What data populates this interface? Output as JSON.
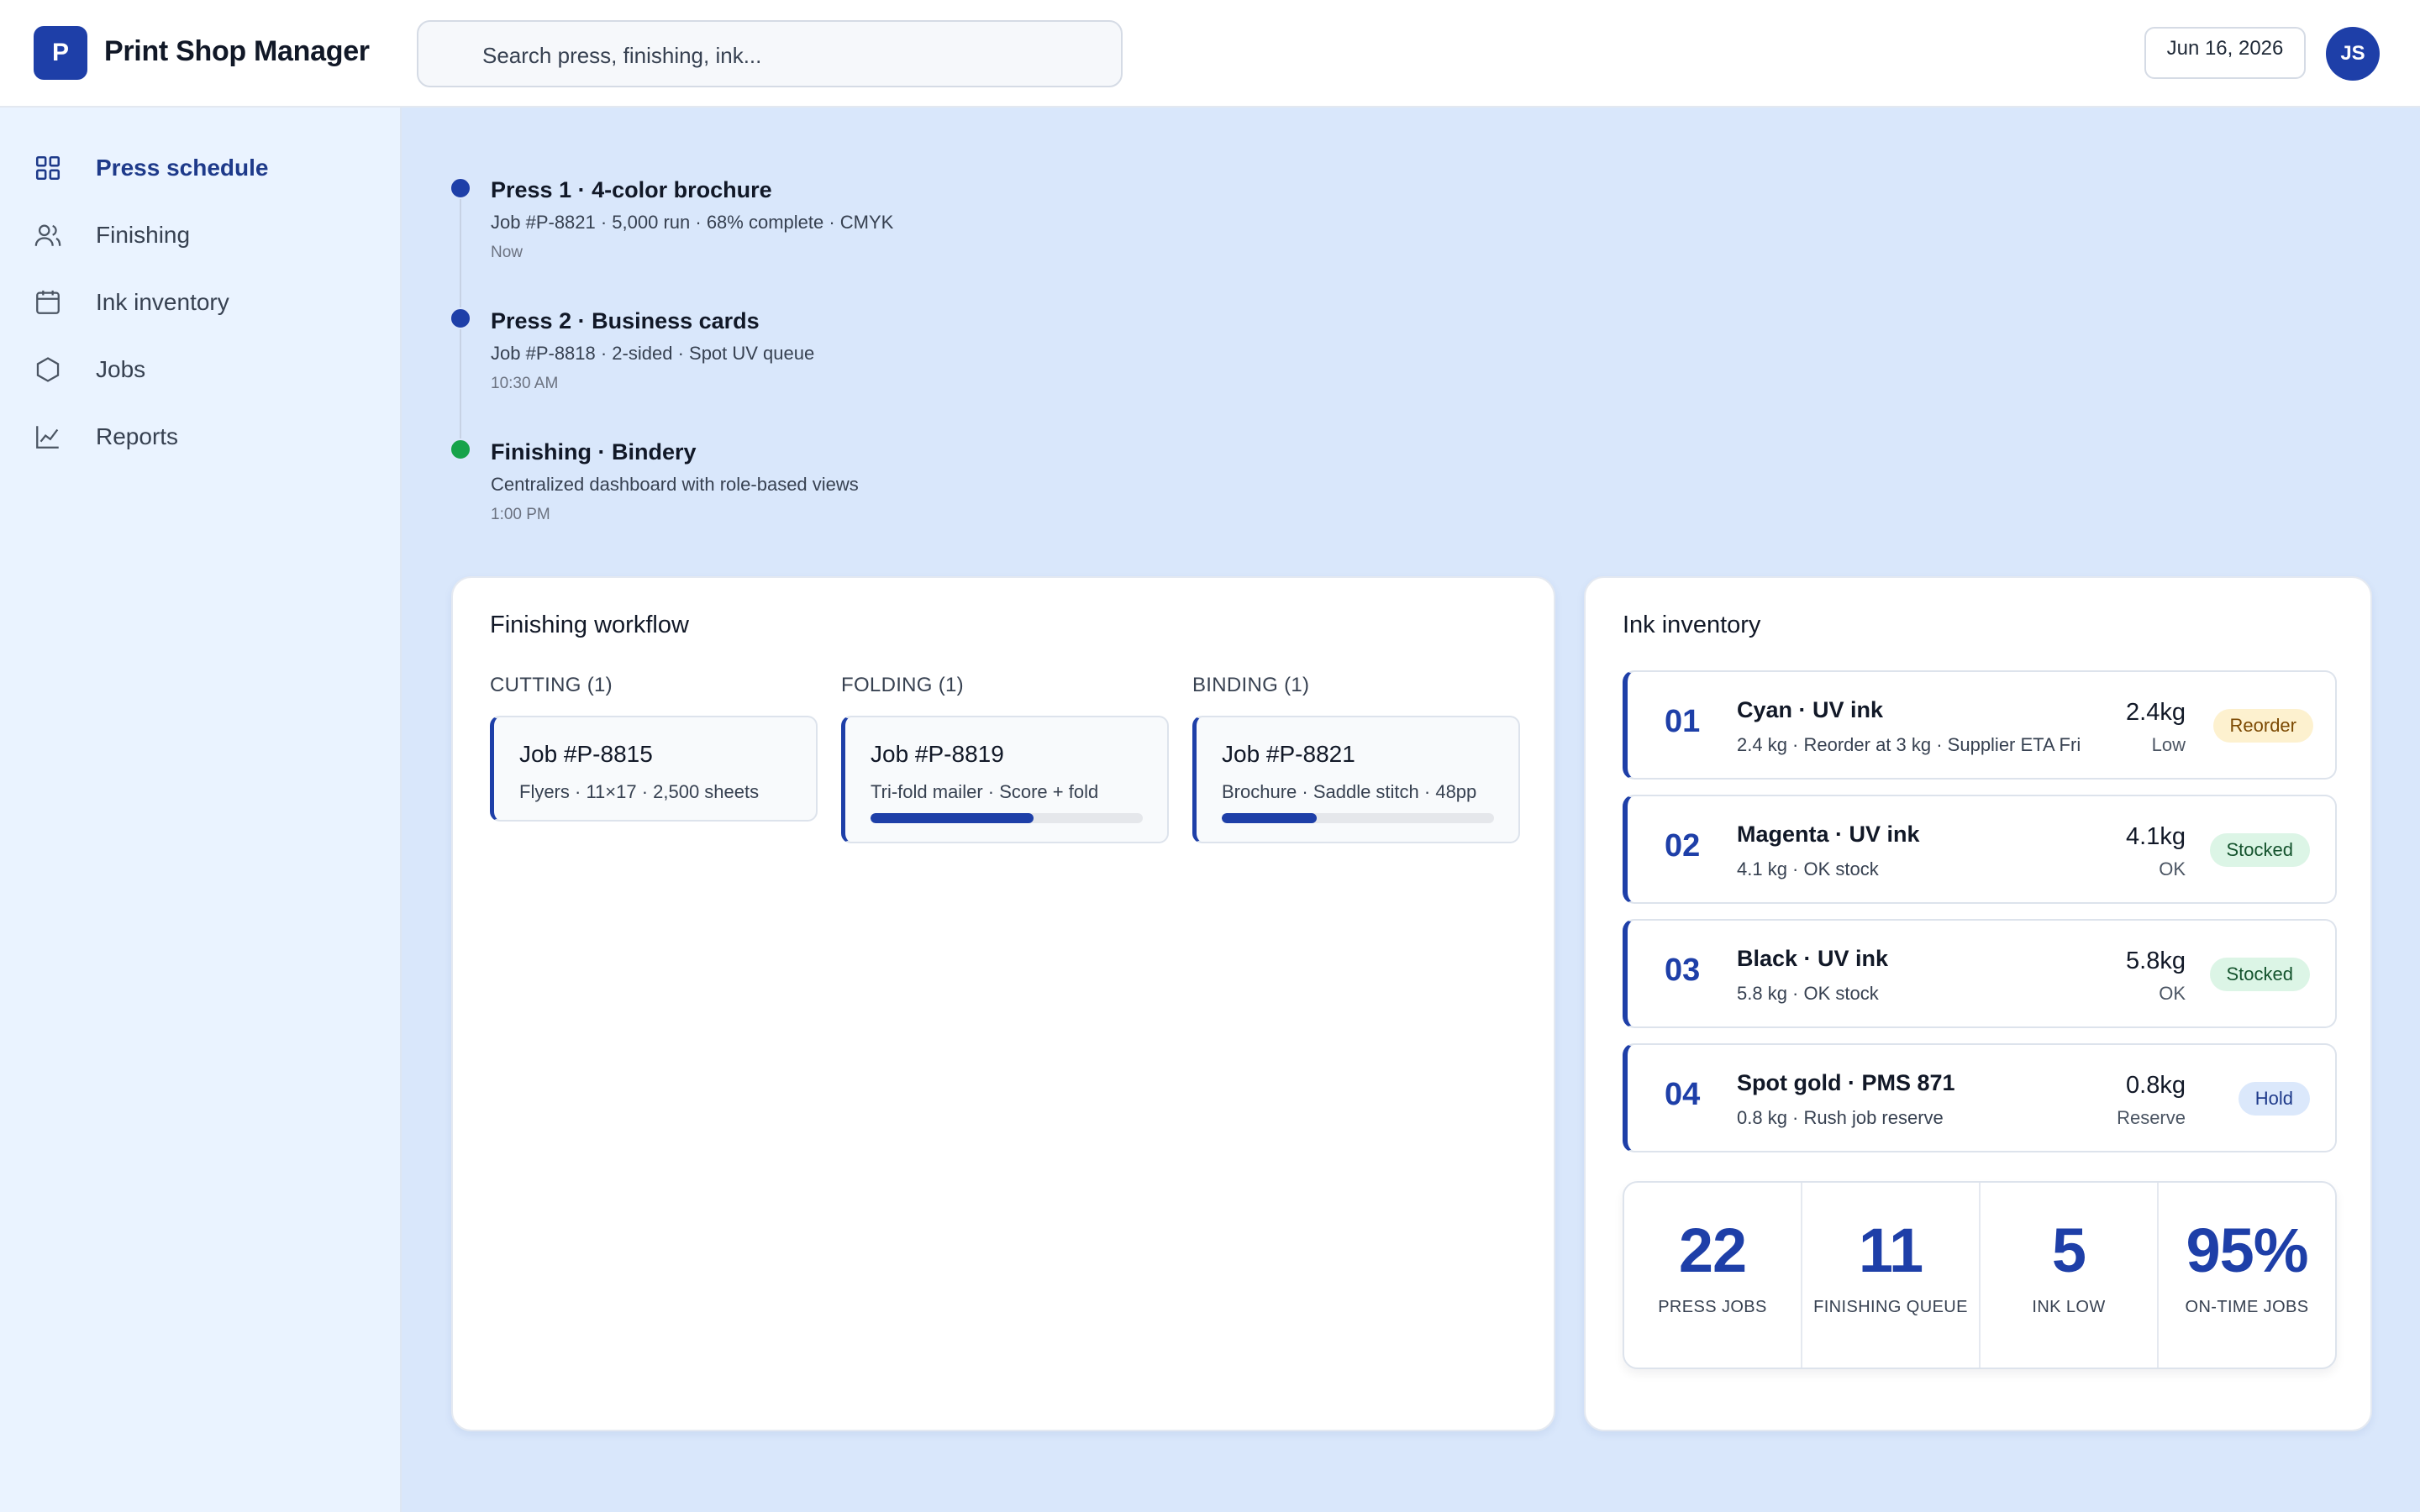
{
  "header": {
    "logo_letter": "P",
    "app_title": "Print Shop Manager",
    "search_placeholder": "Search press, finishing, ink...",
    "date": "Jun 16, 2026",
    "user_initials": "JS"
  },
  "sidebar": {
    "items": [
      {
        "label": "Press schedule",
        "icon": "grid-icon",
        "active": true
      },
      {
        "label": "Finishing",
        "icon": "users-icon"
      },
      {
        "label": "Ink inventory",
        "icon": "calendar-icon"
      },
      {
        "label": "Jobs",
        "icon": "hexagon-icon"
      },
      {
        "label": "Reports",
        "icon": "chart-line-icon"
      }
    ]
  },
  "timeline": [
    {
      "title": "Press 1 · 4-color brochure",
      "desc": "Job #P-8821 · 5,000 run · 68% complete · CMYK",
      "time": "Now",
      "color": "#1e3fa8"
    },
    {
      "title": "Press 2 · Business cards",
      "desc": "Job #P-8818 · 2-sided · Spot UV queue",
      "time": "10:30 AM",
      "color": "#1e3fa8"
    },
    {
      "title": "Finishing · Bindery",
      "desc": "Centralized dashboard with role-based views",
      "time": "1:00 PM",
      "color": "#16a34a"
    }
  ],
  "finishing": {
    "title": "Finishing workflow",
    "columns": [
      {
        "heading": "CUTTING (1)",
        "job": "Job #P-8815",
        "desc": "Flyers · 11×17 · 2,500 sheets",
        "progress": null
      },
      {
        "heading": "FOLDING (1)",
        "job": "Job #P-8819",
        "desc": "Tri-fold mailer · Score + fold",
        "progress": 0.6
      },
      {
        "heading": "BINDING (1)",
        "job": "Job #P-8821",
        "desc": "Brochure · Saddle stitch · 48pp",
        "progress": 0.35
      }
    ]
  },
  "ink": {
    "title": "Ink inventory",
    "rows": [
      {
        "num": "01",
        "name": "Cyan · UV ink",
        "desc": "2.4 kg · Reorder at 3 kg · Supplier ETA Fri",
        "amount": "2.4kg",
        "status": "Low",
        "badge": "Reorder",
        "badge_type": "reorder"
      },
      {
        "num": "02",
        "name": "Magenta · UV ink",
        "desc": "4.1 kg · OK stock",
        "amount": "4.1kg",
        "status": "OK",
        "badge": "Stocked",
        "badge_type": "stocked"
      },
      {
        "num": "03",
        "name": "Black · UV ink",
        "desc": "5.8 kg · OK stock",
        "amount": "5.8kg",
        "status": "OK",
        "badge": "Stocked",
        "badge_type": "stocked"
      },
      {
        "num": "04",
        "name": "Spot gold · PMS 871",
        "desc": "0.8 kg · Rush job reserve",
        "amount": "0.8kg",
        "status": "Reserve",
        "badge": "Hold",
        "badge_type": "hold"
      }
    ],
    "stats": [
      {
        "value": "22",
        "label": "PRESS JOBS"
      },
      {
        "value": "11",
        "label": "FINISHING QUEUE"
      },
      {
        "value": "5",
        "label": "INK LOW"
      },
      {
        "value": "95%",
        "label": "ON-TIME JOBS"
      }
    ]
  }
}
